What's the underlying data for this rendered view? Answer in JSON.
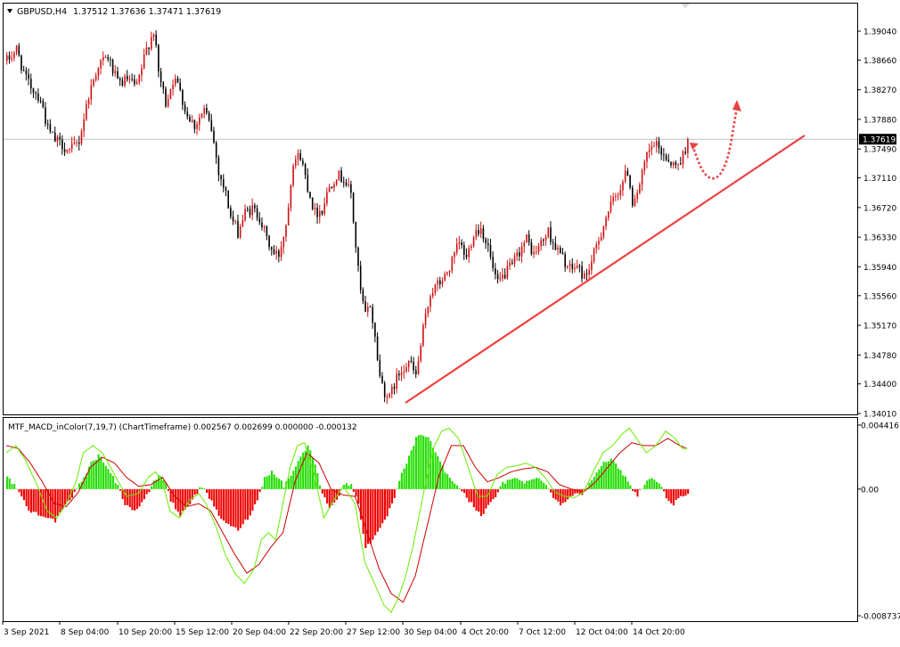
{
  "header": {
    "symbol": "GBPUSD,H4",
    "ohlc": "1.37512 1.37636 1.37471 1.37619"
  },
  "colors": {
    "background": "#ffffff",
    "frame": "#000000",
    "bull": "#d01010",
    "bear": "#000000",
    "hist_positive": "#22dd00",
    "hist_negative": "#ee0000",
    "macd_line": "#66ee00",
    "signal_line": "#cc0000",
    "trendline": "#f04040",
    "forecast_arrow": "#e84040",
    "price_line": "#c0c0c0",
    "price_badge": "#000000"
  },
  "price_panel": {
    "current_price": 1.37619,
    "current_price_label": "1.37619",
    "y_ticks": [
      "1.39040",
      "1.38660",
      "1.38270",
      "1.37880",
      "1.37490",
      "1.37110",
      "1.36720",
      "1.36330",
      "1.35940",
      "1.35560",
      "1.35170",
      "1.34780",
      "1.34400",
      "1.34010"
    ]
  },
  "indicator_panel": {
    "title": "MTF_MACD_inColor(7,19,7) (ChartTimeframe) 0.002567 0.002699 0.000000 -0.000132",
    "y_ticks": [
      "0.004416",
      "0.00",
      "-0.008737"
    ]
  },
  "x_axis": {
    "labels": [
      "3 Sep 2021",
      "8 Sep 04:00",
      "10 Sep 20:00",
      "15 Sep 12:00",
      "20 Sep 04:00",
      "22 Sep 20:00",
      "27 Sep 12:00",
      "30 Sep 04:00",
      "4 Oct 20:00",
      "7 Oct 12:00",
      "12 Oct 04:00",
      "14 Oct 20:00"
    ]
  },
  "chart_data": [
    {
      "type": "candlestick",
      "symbol": "GBPUSD",
      "timeframe": "H4",
      "ylim": [
        1.3401,
        1.3942
      ],
      "anchors": [
        [
          0,
          1.3865
        ],
        [
          4,
          1.388
        ],
        [
          8,
          1.384
        ],
        [
          14,
          1.3815
        ],
        [
          17,
          1.3775
        ],
        [
          20,
          1.376
        ],
        [
          23,
          1.3755
        ],
        [
          26,
          1.3745
        ],
        [
          30,
          1.376
        ],
        [
          34,
          1.382
        ],
        [
          38,
          1.386
        ],
        [
          42,
          1.387
        ],
        [
          46,
          1.3835
        ],
        [
          50,
          1.384
        ],
        [
          54,
          1.383
        ],
        [
          58,
          1.388
        ],
        [
          61,
          1.3905
        ],
        [
          63,
          1.385
        ],
        [
          66,
          1.381
        ],
        [
          69,
          1.384
        ],
        [
          72,
          1.383
        ],
        [
          74,
          1.38
        ],
        [
          78,
          1.378
        ],
        [
          82,
          1.38
        ],
        [
          85,
          1.3775
        ],
        [
          88,
          1.372
        ],
        [
          91,
          1.369
        ],
        [
          93,
          1.366
        ],
        [
          96,
          1.364
        ],
        [
          99,
          1.3665
        ],
        [
          102,
          1.367
        ],
        [
          105,
          1.366
        ],
        [
          108,
          1.363
        ],
        [
          111,
          1.361
        ],
        [
          113,
          1.361
        ],
        [
          116,
          1.365
        ],
        [
          119,
          1.3735
        ],
        [
          122,
          1.374
        ],
        [
          125,
          1.37
        ],
        [
          128,
          1.3665
        ],
        [
          131,
          1.367
        ],
        [
          134,
          1.37
        ],
        [
          137,
          1.3715
        ],
        [
          140,
          1.371
        ],
        [
          143,
          1.369
        ],
        [
          145,
          1.362
        ],
        [
          147,
          1.356
        ],
        [
          149,
          1.353
        ],
        [
          151,
          1.3545
        ],
        [
          153,
          1.35
        ],
        [
          155,
          1.345
        ],
        [
          157,
          1.343
        ],
        [
          159,
          1.342
        ],
        [
          161,
          1.344
        ],
        [
          164,
          1.346
        ],
        [
          167,
          1.347
        ],
        [
          170,
          1.345
        ],
        [
          173,
          1.351
        ],
        [
          176,
          1.356
        ],
        [
          179,
          1.357
        ],
        [
          182,
          1.358
        ],
        [
          185,
          1.36
        ],
        [
          188,
          1.3625
        ],
        [
          191,
          1.3605
        ],
        [
          194,
          1.364
        ],
        [
          197,
          1.3645
        ],
        [
          200,
          1.362
        ],
        [
          202,
          1.359
        ],
        [
          204,
          1.357
        ],
        [
          207,
          1.3585
        ],
        [
          210,
          1.3595
        ],
        [
          213,
          1.3615
        ],
        [
          216,
          1.363
        ],
        [
          219,
          1.361
        ],
        [
          222,
          1.3625
        ],
        [
          225,
          1.364
        ],
        [
          228,
          1.362
        ],
        [
          231,
          1.3605
        ],
        [
          234,
          1.359
        ],
        [
          237,
          1.3595
        ],
        [
          240,
          1.358
        ],
        [
          243,
          1.36
        ],
        [
          246,
          1.363
        ],
        [
          249,
          1.366
        ],
        [
          252,
          1.368
        ],
        [
          255,
          1.37
        ],
        [
          258,
          1.372
        ],
        [
          260,
          1.368
        ],
        [
          263,
          1.37
        ],
        [
          266,
          1.374
        ],
        [
          269,
          1.3755
        ],
        [
          272,
          1.3745
        ],
        [
          275,
          1.3735
        ],
        [
          278,
          1.3725
        ],
        [
          281,
          1.374
        ],
        [
          283,
          1.3762
        ]
      ],
      "note": "Anchor pairs are [bar index, approximate price]; the script draws one candle per bar from them."
    },
    {
      "type": "macd_histogram_lines",
      "ylim": [
        -0.008737,
        0.004416
      ],
      "histogram_anchors": [
        [
          0,
          0.0008
        ],
        [
          3,
          0.0003
        ],
        [
          5,
          -0.0002
        ],
        [
          9,
          -0.0015
        ],
        [
          15,
          -0.0018
        ],
        [
          20,
          -0.0022
        ],
        [
          24,
          -0.0012
        ],
        [
          28,
          -0.0003
        ],
        [
          31,
          0.0006
        ],
        [
          35,
          0.0018
        ],
        [
          38,
          0.0023
        ],
        [
          42,
          0.0015
        ],
        [
          46,
          0.0002
        ],
        [
          49,
          -0.001
        ],
        [
          53,
          -0.0015
        ],
        [
          57,
          -0.0008
        ],
        [
          60,
          0.0002
        ],
        [
          63,
          0.001
        ],
        [
          66,
          0.0005
        ],
        [
          68,
          -0.0008
        ],
        [
          72,
          -0.0018
        ],
        [
          75,
          -0.0012
        ],
        [
          78,
          -0.0004
        ],
        [
          81,
          0.0002
        ],
        [
          84,
          -0.0006
        ],
        [
          88,
          -0.0018
        ],
        [
          92,
          -0.0025
        ],
        [
          96,
          -0.0028
        ],
        [
          100,
          -0.002
        ],
        [
          104,
          -0.0008
        ],
        [
          107,
          0.0008
        ],
        [
          110,
          0.0012
        ],
        [
          113,
          0.0008
        ],
        [
          115,
          0.0002
        ],
        [
          118,
          0.001
        ],
        [
          122,
          0.0022
        ],
        [
          125,
          0.003
        ],
        [
          128,
          0.0018
        ],
        [
          131,
          -0.0004
        ],
        [
          134,
          -0.0012
        ],
        [
          137,
          -0.0007
        ],
        [
          140,
          0.0003
        ],
        [
          143,
          0.0003
        ],
        [
          146,
          -0.001
        ],
        [
          149,
          -0.004
        ],
        [
          152,
          -0.0035
        ],
        [
          155,
          -0.0028
        ],
        [
          158,
          -0.0018
        ],
        [
          161,
          -0.0006
        ],
        [
          164,
          0.001
        ],
        [
          167,
          0.0022
        ],
        [
          170,
          0.0035
        ],
        [
          173,
          0.0038
        ],
        [
          176,
          0.0033
        ],
        [
          179,
          0.0022
        ],
        [
          182,
          0.0012
        ],
        [
          185,
          0.0006
        ],
        [
          188,
          0.0001
        ],
        [
          191,
          -0.0006
        ],
        [
          194,
          -0.0012
        ],
        [
          197,
          -0.0018
        ],
        [
          200,
          -0.0012
        ],
        [
          203,
          -0.0005
        ],
        [
          206,
          0.0004
        ],
        [
          209,
          0.0006
        ],
        [
          212,
          0.0008
        ],
        [
          215,
          0.0005
        ],
        [
          218,
          0.0006
        ],
        [
          221,
          0.0008
        ],
        [
          224,
          0.0004
        ],
        [
          227,
          -0.0006
        ],
        [
          230,
          -0.001
        ],
        [
          233,
          -0.0008
        ],
        [
          236,
          -0.0002
        ],
        [
          239,
          -0.0004
        ],
        [
          242,
          0.0005
        ],
        [
          245,
          0.0012
        ],
        [
          248,
          0.0018
        ],
        [
          251,
          0.002
        ],
        [
          254,
          0.0015
        ],
        [
          257,
          0.0008
        ],
        [
          259,
          0.0002
        ],
        [
          262,
          -0.0004
        ],
        [
          265,
          0.0004
        ],
        [
          268,
          0.0008
        ],
        [
          271,
          0.0004
        ],
        [
          274,
          -0.0006
        ],
        [
          277,
          -0.001
        ],
        [
          280,
          -0.0006
        ],
        [
          283,
          -0.0003
        ]
      ],
      "macd_line_anchors": [
        [
          0,
          0.0025
        ],
        [
          4,
          0.003
        ],
        [
          8,
          0.002
        ],
        [
          13,
          0.0002
        ],
        [
          17,
          -0.0015
        ],
        [
          21,
          -0.002
        ],
        [
          25,
          -0.001
        ],
        [
          29,
          0.0005
        ],
        [
          32,
          0.0025
        ],
        [
          36,
          0.003
        ],
        [
          40,
          0.0025
        ],
        [
          45,
          0.001
        ],
        [
          50,
          -0.0005
        ],
        [
          55,
          -0.0003
        ],
        [
          59,
          0.0008
        ],
        [
          62,
          0.0012
        ],
        [
          65,
          0.0005
        ],
        [
          68,
          -0.0015
        ],
        [
          72,
          -0.002
        ],
        [
          76,
          -0.0008
        ],
        [
          80,
          -0.0003
        ],
        [
          83,
          -0.001
        ],
        [
          87,
          -0.0025
        ],
        [
          91,
          -0.0045
        ],
        [
          95,
          -0.0058
        ],
        [
          99,
          -0.0065
        ],
        [
          103,
          -0.0055
        ],
        [
          106,
          -0.0035
        ],
        [
          109,
          -0.003
        ],
        [
          112,
          -0.0035
        ],
        [
          115,
          -0.001
        ],
        [
          118,
          0.0015
        ],
        [
          121,
          0.003
        ],
        [
          124,
          0.0032
        ],
        [
          128,
          0.001
        ],
        [
          132,
          -0.002
        ],
        [
          136,
          -0.0008
        ],
        [
          140,
          0.0002
        ],
        [
          145,
          -0.001
        ],
        [
          149,
          -0.005
        ],
        [
          153,
          -0.0065
        ],
        [
          157,
          -0.008
        ],
        [
          160,
          -0.0085
        ],
        [
          163,
          -0.0075
        ],
        [
          166,
          -0.006
        ],
        [
          169,
          -0.004
        ],
        [
          172,
          -0.0015
        ],
        [
          175,
          0.001
        ],
        [
          178,
          0.003
        ],
        [
          181,
          0.004
        ],
        [
          184,
          0.0042
        ],
        [
          188,
          0.0035
        ],
        [
          192,
          0.0015
        ],
        [
          196,
          -0.0005
        ],
        [
          200,
          -0.0005
        ],
        [
          204,
          0.001
        ],
        [
          208,
          0.0015
        ],
        [
          212,
          0.0016
        ],
        [
          216,
          0.0018
        ],
        [
          220,
          0.0015
        ],
        [
          224,
          0.0008
        ],
        [
          228,
          -0.0002
        ],
        [
          232,
          -0.0005
        ],
        [
          236,
          -0.0006
        ],
        [
          240,
          -0.0002
        ],
        [
          244,
          0.0012
        ],
        [
          248,
          0.0025
        ],
        [
          252,
          0.003
        ],
        [
          256,
          0.0038
        ],
        [
          259,
          0.0042
        ],
        [
          262,
          0.0035
        ],
        [
          266,
          0.0025
        ],
        [
          270,
          0.003
        ],
        [
          274,
          0.004
        ],
        [
          278,
          0.0035
        ],
        [
          281,
          0.0028
        ],
        [
          283,
          0.0028
        ]
      ],
      "signal_line_anchors": [
        [
          0,
          0.003
        ],
        [
          5,
          0.0028
        ],
        [
          10,
          0.0018
        ],
        [
          15,
          0.0005
        ],
        [
          20,
          -0.001
        ],
        [
          25,
          -0.0012
        ],
        [
          30,
          -0.0002
        ],
        [
          35,
          0.0015
        ],
        [
          40,
          0.0022
        ],
        [
          45,
          0.0018
        ],
        [
          50,
          0.0008
        ],
        [
          55,
          0.0002
        ],
        [
          60,
          0.0003
        ],
        [
          65,
          0.0008
        ],
        [
          70,
          -0.0005
        ],
        [
          75,
          -0.0012
        ],
        [
          80,
          -0.001
        ],
        [
          85,
          -0.0015
        ],
        [
          90,
          -0.003
        ],
        [
          95,
          -0.0045
        ],
        [
          100,
          -0.0058
        ],
        [
          105,
          -0.0052
        ],
        [
          110,
          -0.004
        ],
        [
          115,
          -0.003
        ],
        [
          120,
          0.0005
        ],
        [
          125,
          0.0025
        ],
        [
          130,
          0.0018
        ],
        [
          135,
          0.0
        ],
        [
          140,
          -0.0004
        ],
        [
          145,
          -0.0005
        ],
        [
          150,
          -0.003
        ],
        [
          155,
          -0.0055
        ],
        [
          160,
          -0.0072
        ],
        [
          165,
          -0.0078
        ],
        [
          170,
          -0.006
        ],
        [
          175,
          -0.0025
        ],
        [
          180,
          0.001
        ],
        [
          185,
          0.003
        ],
        [
          190,
          0.003
        ],
        [
          195,
          0.0015
        ],
        [
          200,
          0.0005
        ],
        [
          205,
          0.0008
        ],
        [
          210,
          0.0012
        ],
        [
          215,
          0.0014
        ],
        [
          220,
          0.0015
        ],
        [
          225,
          0.0012
        ],
        [
          230,
          0.0003
        ],
        [
          235,
          0.0
        ],
        [
          240,
          -0.0002
        ],
        [
          245,
          0.0005
        ],
        [
          250,
          0.0015
        ],
        [
          255,
          0.0025
        ],
        [
          260,
          0.0032
        ],
        [
          265,
          0.003
        ],
        [
          270,
          0.003
        ],
        [
          275,
          0.0035
        ],
        [
          280,
          0.003
        ],
        [
          283,
          0.0028
        ]
      ]
    }
  ]
}
